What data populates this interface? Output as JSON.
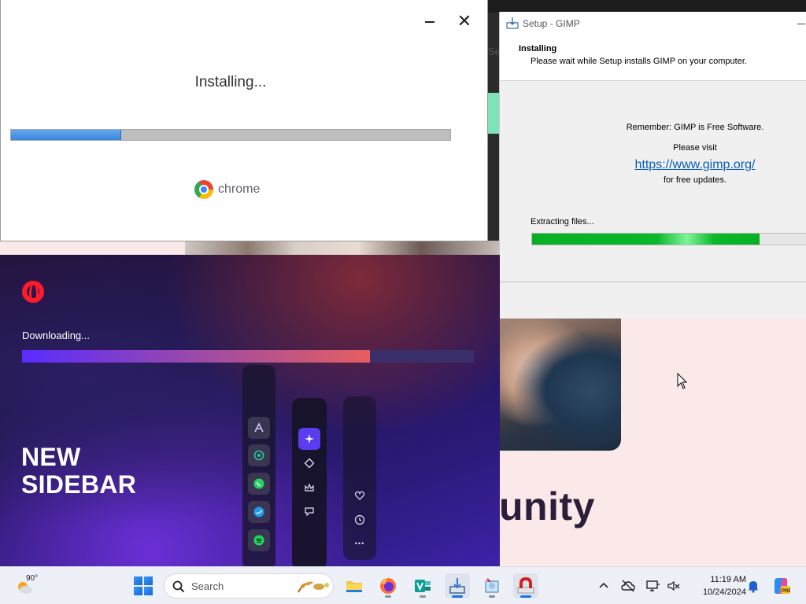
{
  "background_page": {
    "side_text": "Se",
    "heading_fragment": "unity"
  },
  "chrome_installer": {
    "status": "Installing...",
    "progress_fraction": 0.25,
    "brand": "chrome",
    "close_glyph": "✕"
  },
  "gimp_setup": {
    "window_title": "Setup - GIMP",
    "header_title": "Installing",
    "header_subtitle": "Please wait while Setup installs GIMP on your computer.",
    "remember": "Remember: GIMP is Free Software.",
    "please_visit": "Please visit",
    "link": "https://www.gimp.org/",
    "for_updates": "for free updates.",
    "status": "Extracting files...",
    "progress_fraction": 0.83
  },
  "opera_installer": {
    "status": "Downloading...",
    "progress_fraction": 0.77,
    "headline_line1": "NEW",
    "headline_line2": "SIDEBAR",
    "more_glyph": "•••"
  },
  "taskbar": {
    "weather_temp": "90°",
    "search_placeholder": "Search",
    "clock_time": "11:19 AM",
    "clock_date": "10/24/2024",
    "accent_color": "#1a73e8"
  }
}
